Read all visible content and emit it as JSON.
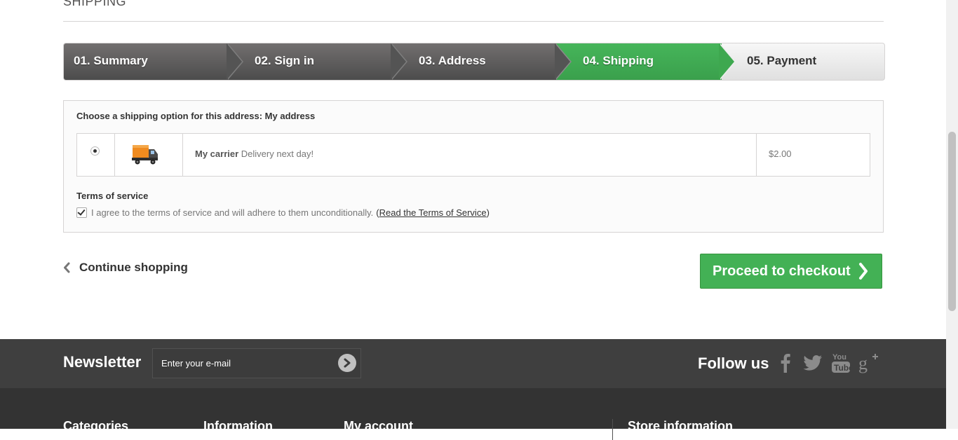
{
  "page": {
    "heading": "SHIPPING"
  },
  "steps": [
    {
      "label": "01. Summary",
      "state": "done"
    },
    {
      "label": "02. Sign in",
      "state": "done"
    },
    {
      "label": "03. Address",
      "state": "done"
    },
    {
      "label": "04. Shipping",
      "state": "current"
    },
    {
      "label": "05. Payment",
      "state": "todo"
    }
  ],
  "shipping": {
    "choose_label": "Choose a shipping option for this address: My address",
    "carrier": {
      "name": "My carrier",
      "delay": "Delivery next day!",
      "price": "$2.00",
      "selected": true,
      "icon": "delivery-truck-icon"
    }
  },
  "terms": {
    "title": "Terms of service",
    "checked": true,
    "agree_text": "I agree to the terms of service and will adhere to them unconditionally.",
    "open_paren": "(",
    "link_text": "Read the Terms of Service",
    "close_paren": ")"
  },
  "actions": {
    "continue_label": "Continue shopping",
    "checkout_label": "Proceed to checkout"
  },
  "footer": {
    "newsletter_title": "Newsletter",
    "newsletter_placeholder": "Enter your e-mail",
    "follow_title": "Follow us",
    "social": [
      "facebook-icon",
      "twitter-icon",
      "youtube-icon",
      "google-plus-icon"
    ],
    "columns": [
      "Categories",
      "Information",
      "My account",
      "Store information"
    ]
  },
  "colors": {
    "accent_green": "#43b155",
    "step_dark": "#5f5f5f",
    "footer_dark": "#3f3f3f"
  }
}
